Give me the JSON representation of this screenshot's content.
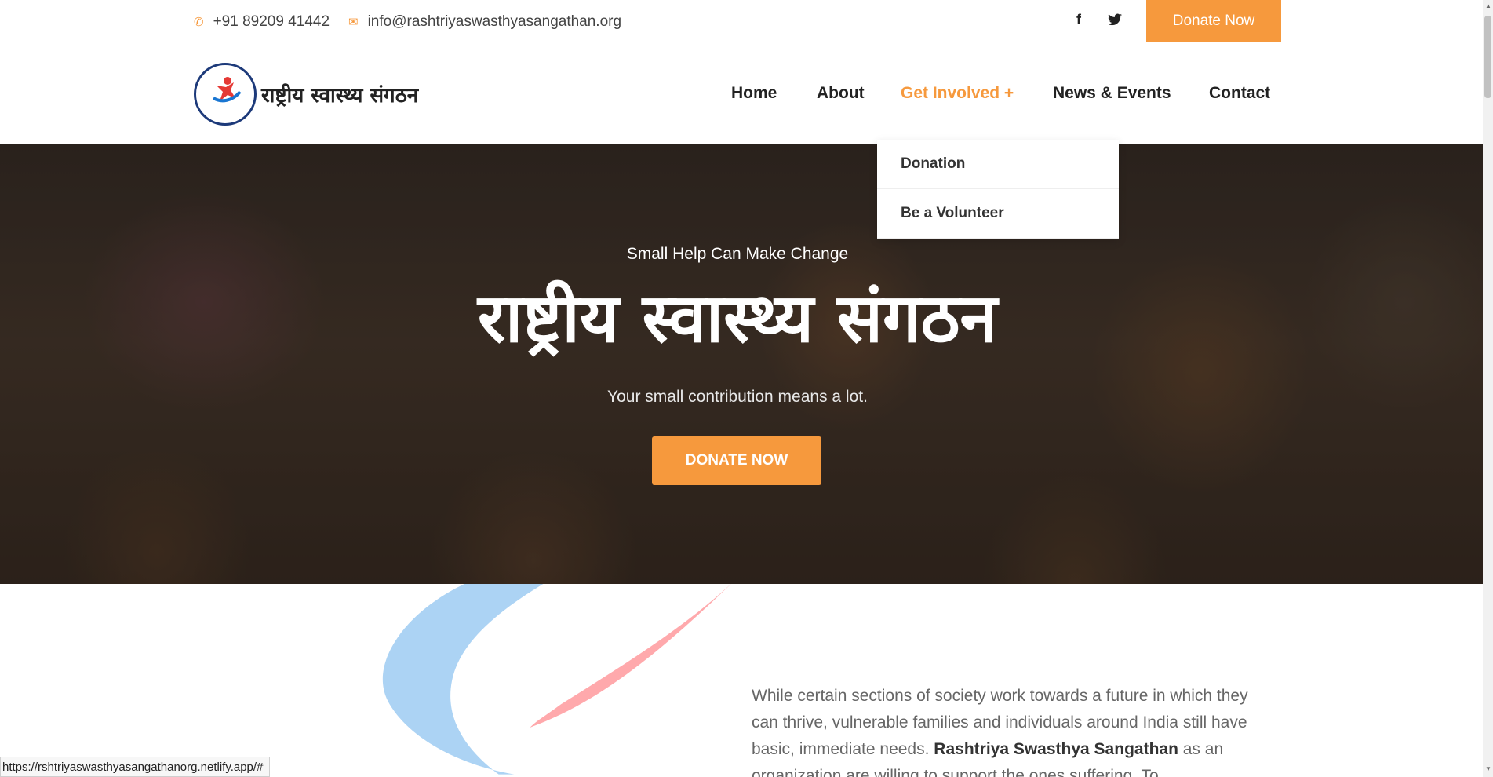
{
  "topbar": {
    "phone": "+91 89209 41442",
    "phone_icon": "phone-icon",
    "email": "info@rashtriyaswasthyasangathan.org",
    "email_icon": "mail-icon",
    "social": [
      {
        "name": "facebook-icon",
        "glyph": "f"
      },
      {
        "name": "twitter-icon",
        "glyph": "🐦"
      }
    ],
    "donate_label": "Donate Now"
  },
  "header": {
    "logo_text": "राष्ट्रीय स्वास्थ्य संगठन",
    "nav": [
      {
        "label": "Home",
        "active": false
      },
      {
        "label": "About",
        "active": false
      },
      {
        "label": "Get Involved +",
        "active": true
      },
      {
        "label": "News & Events",
        "active": false
      },
      {
        "label": "Contact",
        "active": false
      }
    ]
  },
  "dropdown": {
    "items": [
      "Donation",
      "Be a Volunteer"
    ]
  },
  "hero": {
    "subtitle": "Small Help Can Make Change",
    "title": "राष्ट्रीय स्वास्थ्य संगठन",
    "tagline": "Your small contribution means a lot.",
    "button": "DONATE NOW"
  },
  "about": {
    "text_start": "While certain sections of society work towards a future in which they can thrive, vulnerable families and individuals around India still have basic, immediate needs.",
    "org_name": "Rashtriya Swasthya Sangathan",
    "text_end": "as an organization are willing to support the ones suffering. To"
  },
  "status_url": "https://rshtriyaswasthyasangathanorg.netlify.app/#",
  "colors": {
    "accent": "#f6993d",
    "ribbon_pink": "#ff9a9e",
    "ribbon_blue": "#9ecbf2"
  }
}
